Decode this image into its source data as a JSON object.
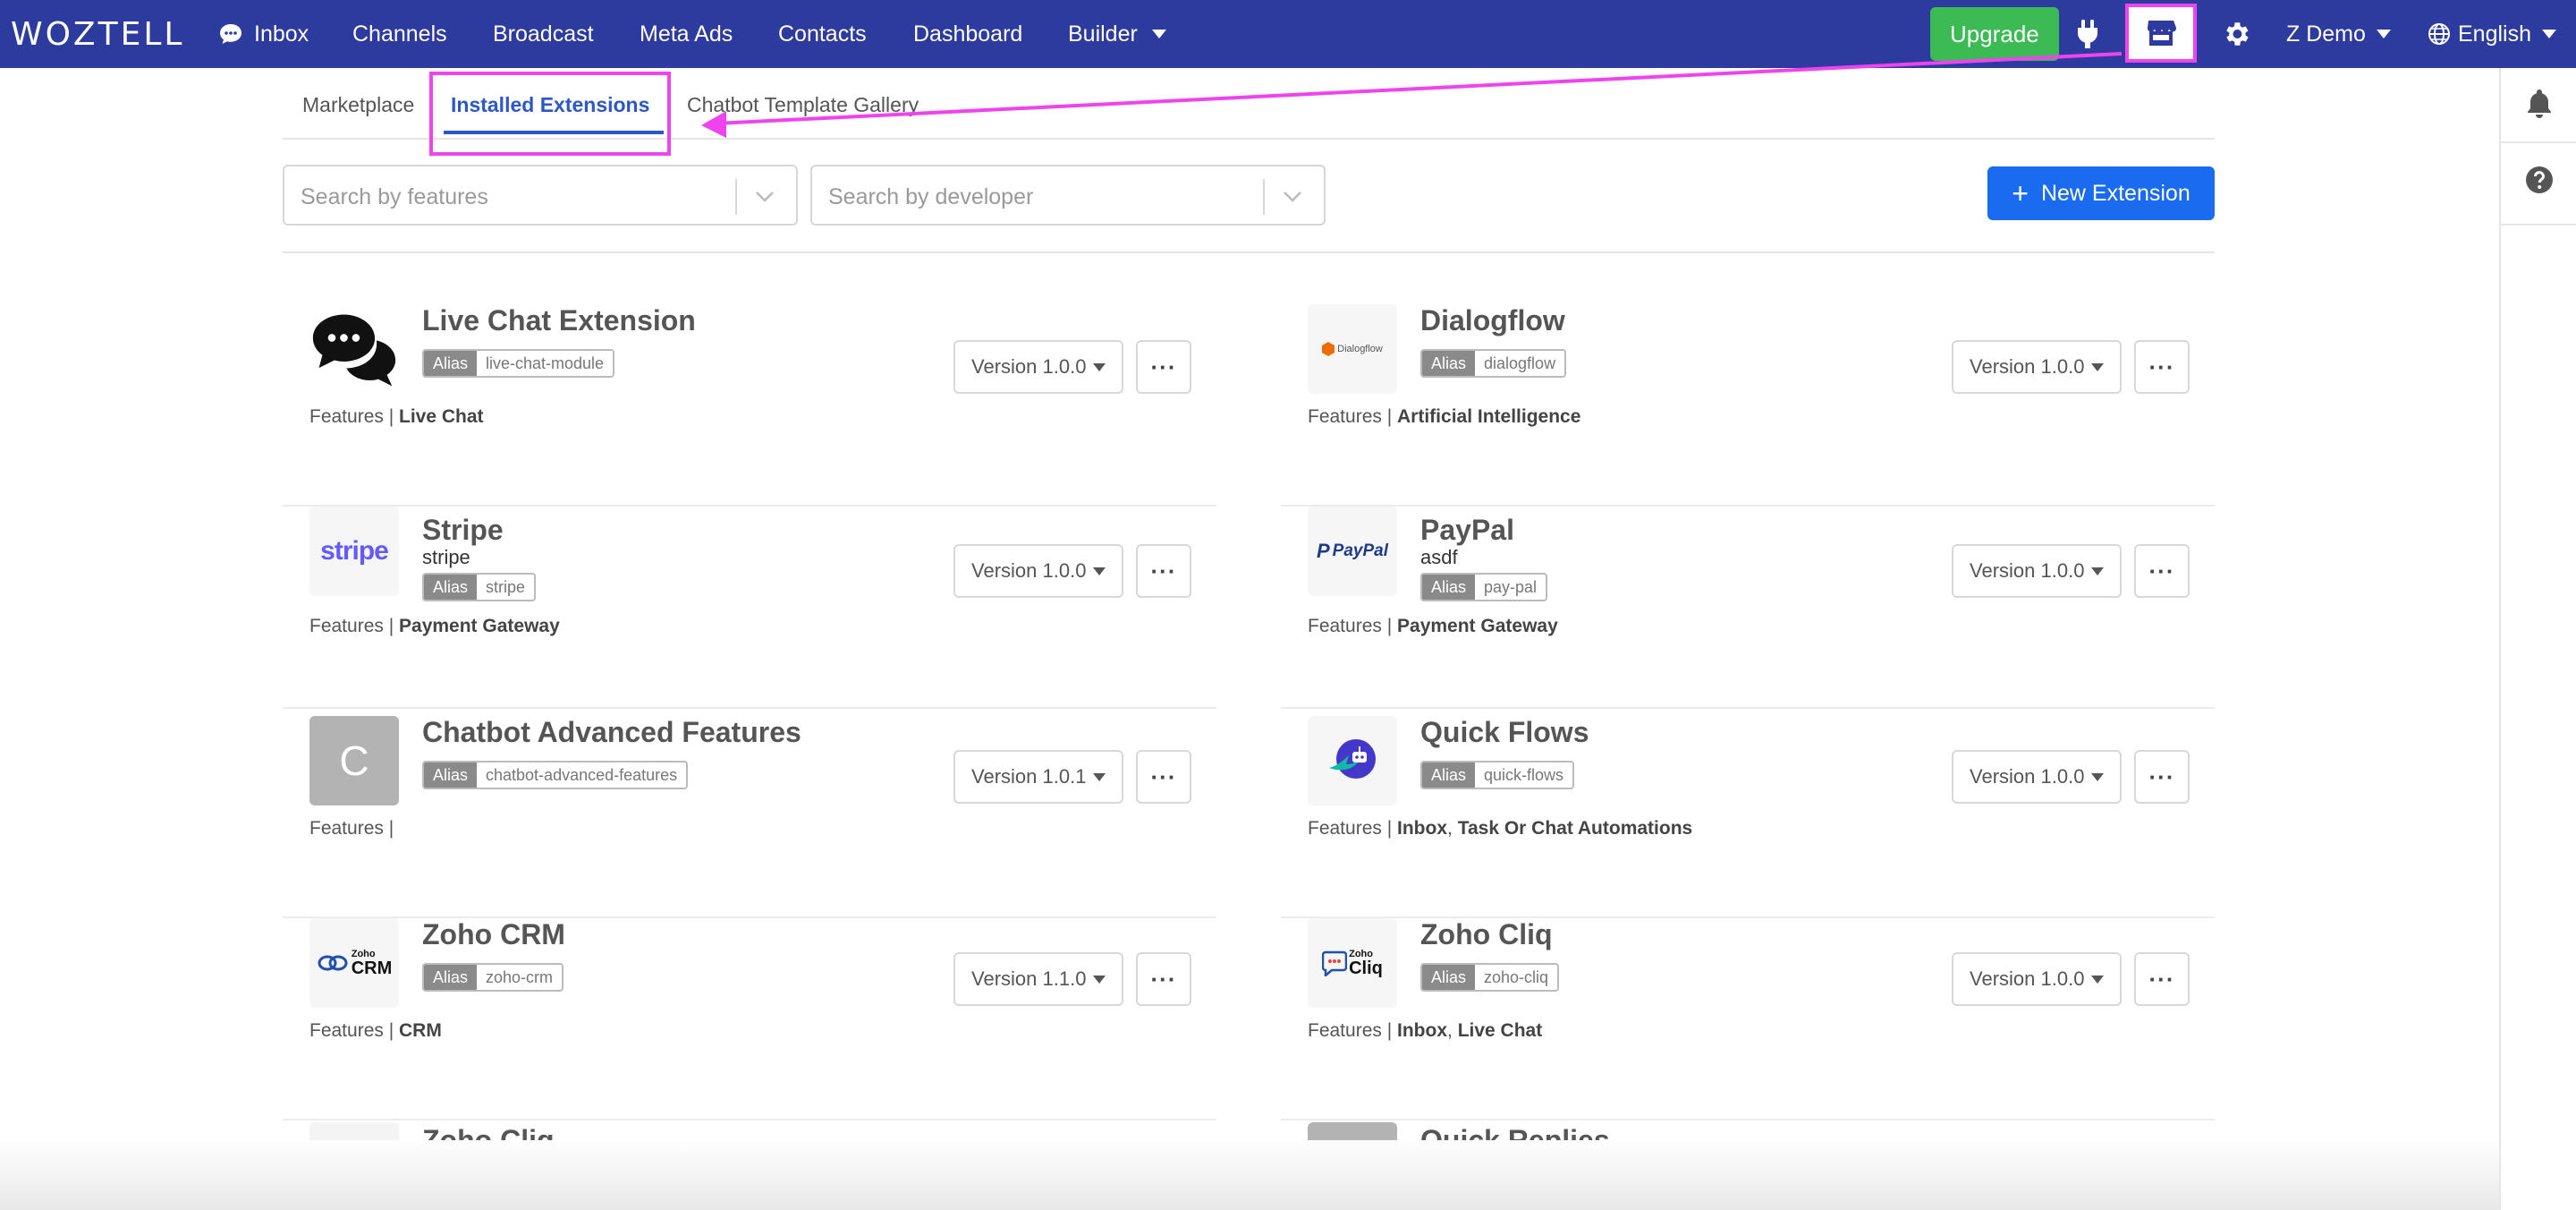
{
  "navbar": {
    "logo": "WOZTELL",
    "items": [
      "Inbox",
      "Channels",
      "Broadcast",
      "Meta Ads",
      "Contacts",
      "Dashboard",
      "Builder"
    ],
    "upgrade_label": "Upgrade",
    "user_label": "Z Demo",
    "language_label": "English",
    "highlight_color": "#ee44ee",
    "bg_color": "#2d3a9e"
  },
  "tabs": [
    {
      "label": "Marketplace",
      "active": false
    },
    {
      "label": "Installed Extensions",
      "active": true
    },
    {
      "label": "Chatbot Template Gallery",
      "active": false
    }
  ],
  "filters": {
    "features_placeholder": "Search by features",
    "developer_placeholder": "Search by developer",
    "new_extension_label": "New Extension",
    "new_extension_plus": "+"
  },
  "alias_key": "Alias",
  "features_prefix": "Features |",
  "more_label": "···",
  "extensions": [
    {
      "name": "Live Chat Extension",
      "subtitle": "",
      "alias": "live-chat-module",
      "features": [
        "Live Chat"
      ],
      "version": "Version 1.0.0",
      "icon": "chat-bubbles-icon"
    },
    {
      "name": "Dialogflow",
      "subtitle": "",
      "alias": "dialogflow",
      "features": [
        "Artificial Intelligence"
      ],
      "version": "Version 1.0.0",
      "icon": "dialogflow-logo",
      "icon_text": "Dialogflow"
    },
    {
      "name": "Stripe",
      "subtitle": "stripe",
      "alias": "stripe",
      "features": [
        "Payment Gateway"
      ],
      "version": "Version 1.0.0",
      "icon": "stripe-logo",
      "icon_text": "stripe"
    },
    {
      "name": "PayPal",
      "subtitle": "asdf",
      "alias": "pay-pal",
      "features": [
        "Payment Gateway"
      ],
      "version": "Version 1.0.0",
      "icon": "paypal-logo",
      "icon_text": "PayPal"
    },
    {
      "name": "Chatbot Advanced Features",
      "subtitle": "",
      "alias": "chatbot-advanced-features",
      "features": [],
      "version": "Version 1.0.1",
      "icon": "letter-avatar",
      "icon_text": "C"
    },
    {
      "name": "Quick Flows",
      "subtitle": "",
      "alias": "quick-flows",
      "features": [
        "Inbox",
        "Task Or Chat Automations"
      ],
      "version": "Version 1.0.0",
      "icon": "quick-flows-logo"
    },
    {
      "name": "Zoho CRM",
      "subtitle": "",
      "alias": "zoho-crm",
      "features": [
        "CRM"
      ],
      "version": "Version 1.1.0",
      "icon": "zoho-crm-logo",
      "icon_text": "Zoho",
      "icon_text2": "CRM"
    },
    {
      "name": "Zoho Cliq",
      "subtitle": "",
      "alias": "zoho-cliq",
      "features": [
        "Inbox",
        "Live Chat"
      ],
      "version": "Version 1.0.0",
      "icon": "zoho-cliq-logo",
      "icon_text": "Zoho",
      "icon_text2": "Cliq"
    },
    {
      "name": "Zoho Cliq",
      "subtitle": "",
      "alias": "",
      "features": [],
      "version": "",
      "icon": "zoho-cliq-logo",
      "partial": true
    },
    {
      "name": "Quick Replies",
      "subtitle": "",
      "alias": "",
      "features": [],
      "version": "",
      "icon": "letter-avatar",
      "partial": true
    }
  ]
}
